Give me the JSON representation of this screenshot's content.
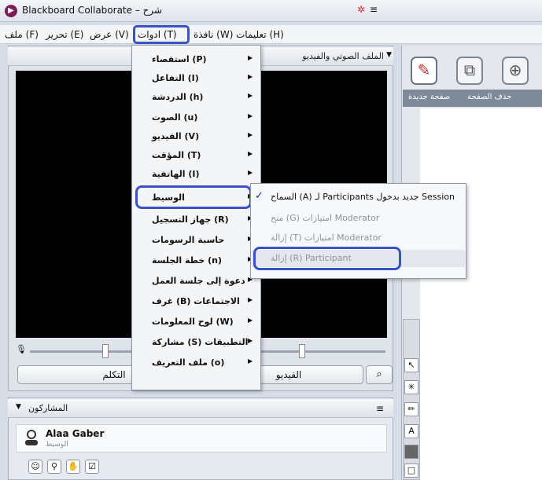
{
  "window": {
    "title": "Blackboard Collaborate – شرح",
    "icon": "blackboard-logo-icon"
  },
  "menubar": {
    "items": [
      {
        "key": "file",
        "label": "ملف (F)"
      },
      {
        "key": "edit",
        "label": "تحرير (E)"
      },
      {
        "key": "view",
        "label": "عرض (V)"
      },
      {
        "key": "tools",
        "label": "ادوات (T)"
      },
      {
        "key": "window",
        "label": "نافذة (W)"
      },
      {
        "key": "help",
        "label": "تعليمات (H)"
      }
    ]
  },
  "av_panel": {
    "title": "الملف الصوتي والفيديو",
    "talk_label": "التكلم",
    "video_label": "الفيديو"
  },
  "participants_panel": {
    "title": "المشاركون",
    "participant": {
      "name": "Alaa Gaber",
      "role": "الوسيط"
    }
  },
  "whiteboard": {
    "tabs": [
      "صفحة جديدة",
      "حذف الصفحة"
    ]
  },
  "tools_menu": {
    "items": [
      {
        "label": "استقصاء (P)",
        "submenu": true
      },
      {
        "label": "التفاعل (I)",
        "submenu": true
      },
      {
        "label": "الدردشة (h)",
        "submenu": true
      },
      {
        "label": "الصوت (u)",
        "submenu": true
      },
      {
        "label": "الفيديو (V)",
        "submenu": true
      },
      {
        "label": "المؤقت (T)",
        "submenu": true
      },
      {
        "label": "الهاتفية (I)",
        "submenu": true
      },
      {
        "label": "الوسيط",
        "submenu": true,
        "highlighted": true
      },
      {
        "label": "جهاز التسجيل (R)",
        "submenu": true
      },
      {
        "label": "حاسبة الرسومات",
        "submenu": true
      },
      {
        "label": "خطة الجلسة (n)",
        "submenu": true
      },
      {
        "label": "دعوة إلى جلسة العمل",
        "submenu": true
      },
      {
        "label": "غرف (B) الاجتماعات",
        "submenu": true
      },
      {
        "label": "لوح المعلومات (W)",
        "submenu": true
      },
      {
        "label": "مشاركة (S) التطبيقات",
        "submenu": true
      },
      {
        "label": "ملف التعريف (o)",
        "submenu": true
      }
    ]
  },
  "moderator_submenu": {
    "items": [
      {
        "label": "السماح (A) لـ Participants جديد بدخول Session",
        "checked": true,
        "enabled": true
      },
      {
        "label": "منح (G) امتيازات Moderator",
        "checked": false,
        "enabled": false
      },
      {
        "label": "إزالة (T) امتيازات Moderator",
        "checked": false,
        "enabled": false
      },
      {
        "label": "إزالة (R) Participant",
        "checked": false,
        "enabled": false,
        "highlighted": true
      }
    ]
  },
  "colors": {
    "highlight_outline": "#3a52c5",
    "video_bg": "#000000"
  }
}
